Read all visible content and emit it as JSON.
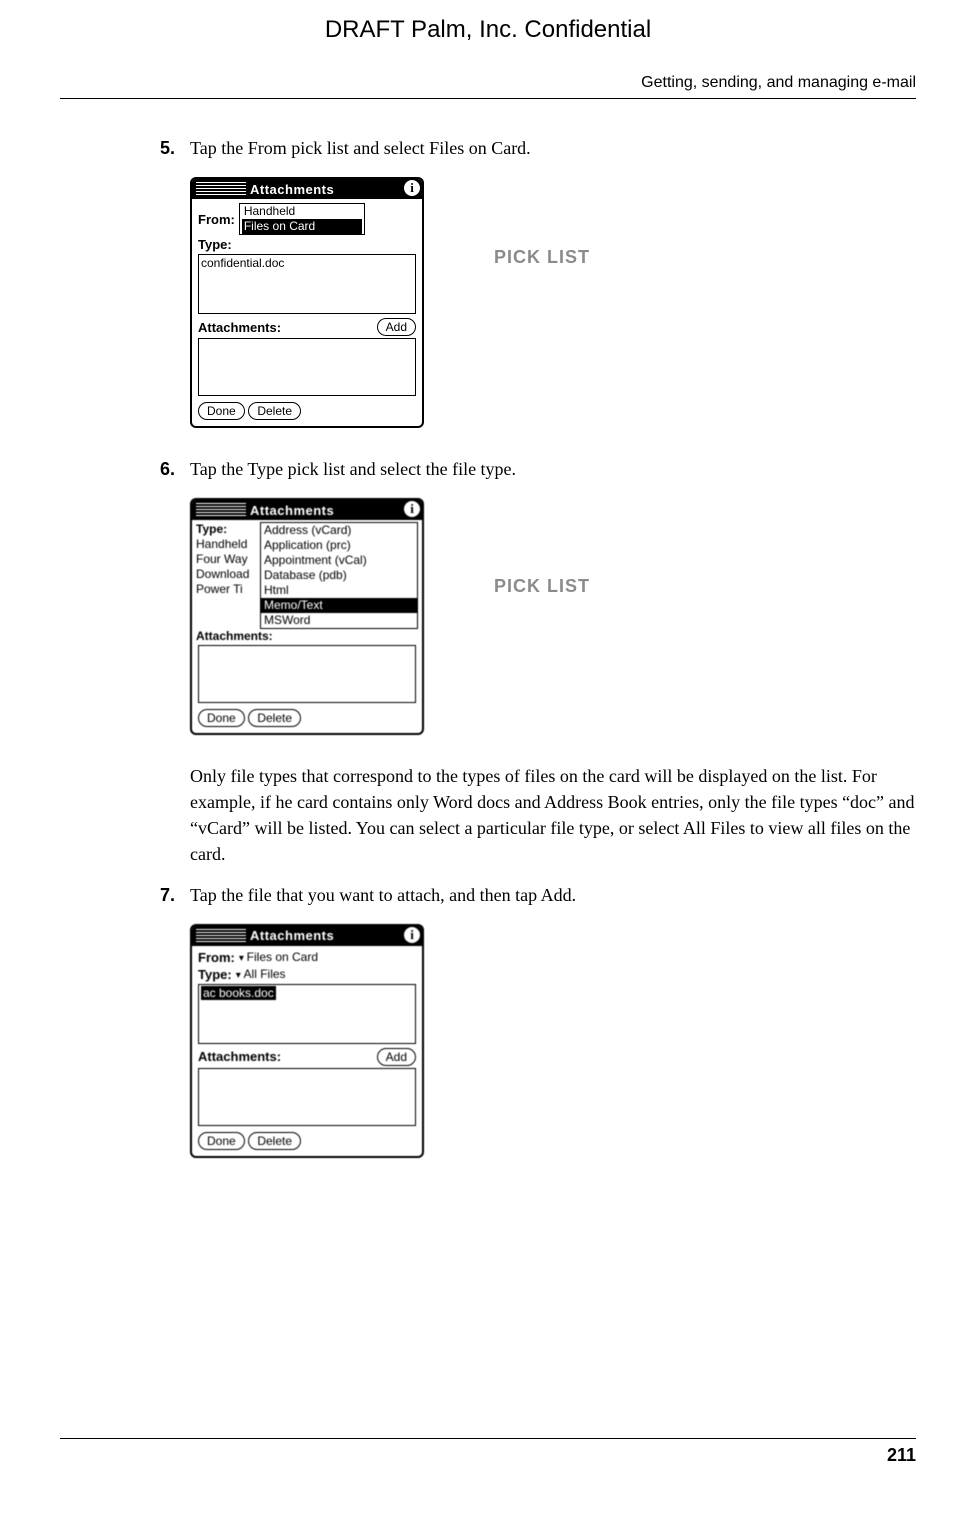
{
  "header": {
    "draft": "DRAFT   Palm, Inc. Confidential",
    "running_head": "Getting, sending, and managing e-mail"
  },
  "steps": {
    "s5": {
      "num": "5.",
      "text": "Tap the From pick list and select Files on Card."
    },
    "s6": {
      "num": "6.",
      "text": "Tap the Type pick list and select the file type."
    },
    "s6_note": "Only file types that correspond to the types of files on the card will be displayed on the list. For example, if he card contains only Word docs and Address Book entries, only the file types “doc” and “vCard” will be listed. You can select a particular file type, or select All Files to view all files on the card.",
    "s7": {
      "num": "7.",
      "text": "Tap the file that you want to attach, and then tap Add."
    }
  },
  "callouts": {
    "picklist": "PICK LIST"
  },
  "dialog_common": {
    "title": "Attachments",
    "info": "i",
    "attachments_label": "Attachments:",
    "add": "Add",
    "done": "Done",
    "delete": "Delete"
  },
  "dialog1": {
    "from_label": "From:",
    "type_label": "Type:",
    "from_opt1": "Handheld",
    "from_opt2": "Files on Card",
    "file": "confidential.doc"
  },
  "dialog2": {
    "type_label": "Type:",
    "left_items": [
      "Handheld",
      "Four Way",
      "Download",
      "Power Ti"
    ],
    "type_opts": [
      "Address (vCard)",
      "Application (prc)",
      "Appointment (vCal)",
      "Database (pdb)",
      "Html",
      "Memo/Text",
      "MSWord"
    ],
    "selected_index": 5
  },
  "dialog3": {
    "from_label": "From:",
    "type_label": "Type:",
    "from_value": "Files on Card",
    "type_value": "All Files",
    "file": "ac books.doc"
  },
  "footer": {
    "page": "211"
  }
}
